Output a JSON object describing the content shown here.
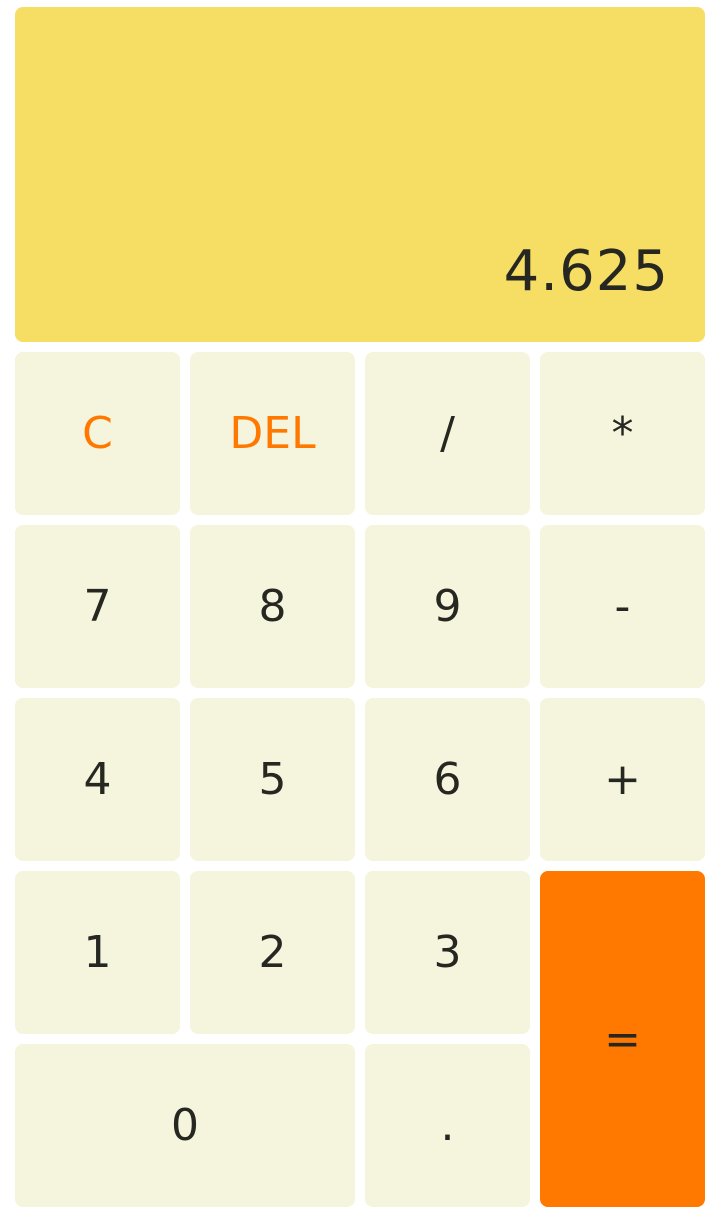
{
  "display": {
    "value": "4.625"
  },
  "colors": {
    "display_bg": "#f6dd63",
    "key_bg": "#f5f4dc",
    "accent": "#ff7800",
    "text": "#272722"
  },
  "keys": {
    "clear": "C",
    "delete": "DEL",
    "divide": "/",
    "multiply": "*",
    "seven": "7",
    "eight": "8",
    "nine": "9",
    "minus": "-",
    "four": "4",
    "five": "5",
    "six": "6",
    "plus": "+",
    "one": "1",
    "two": "2",
    "three": "3",
    "equals": "=",
    "zero": "0",
    "dot": "."
  }
}
